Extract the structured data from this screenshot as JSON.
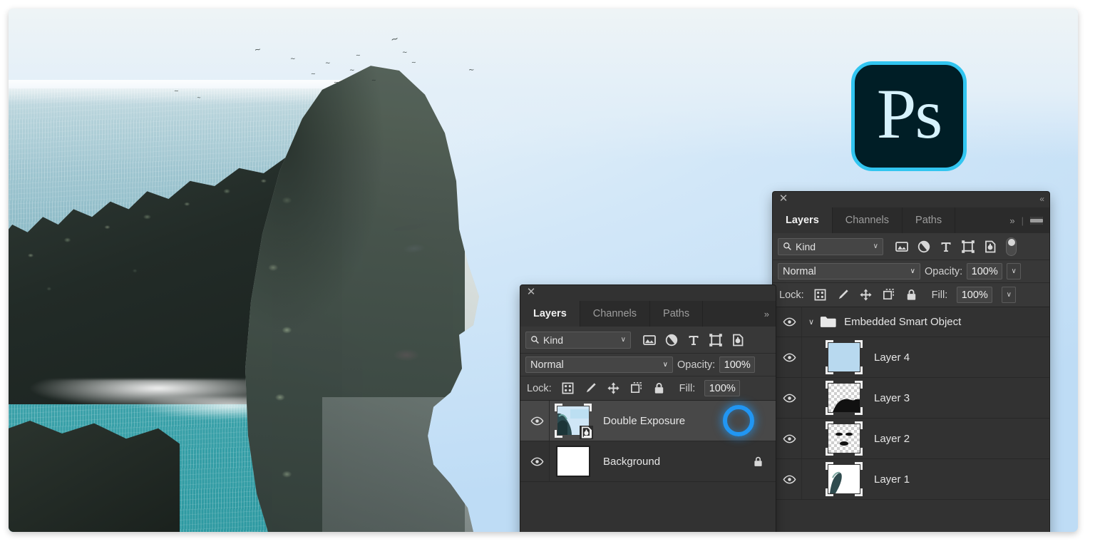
{
  "app": {
    "name": "Adobe Photoshop",
    "icon_label": "Ps",
    "icon_name": "photoshop-app-icon",
    "brand_accent": "#31c5f0",
    "icon_background": "#001e26"
  },
  "artwork": {
    "title": "Double Exposure composite",
    "description": "Woman's profile blended with coastal cliff, ocean and birds",
    "background_color": "#bedcf5"
  },
  "front_panel": {
    "name": "layers-panel-front",
    "titlebar": {
      "close_label": "✕",
      "collapse_label": "«"
    },
    "tabs": [
      {
        "label": "Layers",
        "active": true
      },
      {
        "label": "Channels",
        "active": false
      },
      {
        "label": "Paths",
        "active": false
      }
    ],
    "tab_overflow_label": "»",
    "filter": {
      "search_icon": "search-icon",
      "kind_label": "Kind",
      "caret": "∨",
      "icons": [
        "pixel-layer-filter-icon",
        "adjustment-layer-filter-icon",
        "type-layer-filter-icon",
        "shape-layer-filter-icon",
        "smart-object-filter-icon"
      ],
      "toggle_name": "filter-enable-toggle"
    },
    "blend": {
      "mode": "Normal",
      "caret": "∨",
      "opacity_label": "Opacity:",
      "opacity_value": "100%"
    },
    "lock": {
      "label": "Lock:",
      "icons": [
        "lock-transparent-pixels-icon",
        "lock-image-pixels-icon",
        "lock-position-icon",
        "lock-artboard-nesting-icon",
        "lock-all-icon"
      ],
      "fill_label": "Fill:",
      "fill_value": "100%"
    },
    "layers": [
      {
        "name": "Double Exposure",
        "visible": true,
        "selected": true,
        "thumb_type": "smart-object-photo",
        "locked": false,
        "has_selection_ring": true
      },
      {
        "name": "Background",
        "visible": true,
        "selected": false,
        "thumb_type": "white",
        "locked": true,
        "has_selection_ring": false
      }
    ]
  },
  "back_panel": {
    "name": "layers-panel-back",
    "titlebar": {
      "close_label": "✕",
      "collapse_label": "«"
    },
    "tabs": [
      {
        "label": "Layers",
        "active": true
      },
      {
        "label": "Channels",
        "active": false
      },
      {
        "label": "Paths",
        "active": false
      }
    ],
    "tab_overflow_label": "»",
    "panel_menu_label": "panel-menu-icon",
    "filter": {
      "search_icon": "search-icon",
      "kind_label": "Kind",
      "caret": "∨",
      "icons": [
        "pixel-layer-filter-icon",
        "adjustment-layer-filter-icon",
        "type-layer-filter-icon",
        "shape-layer-filter-icon",
        "smart-object-filter-icon"
      ],
      "toggle_name": "filter-enable-toggle"
    },
    "blend": {
      "mode": "Normal",
      "caret": "∨",
      "opacity_label": "Opacity:",
      "opacity_value": "100%"
    },
    "lock": {
      "label": "Lock:",
      "icons": [
        "lock-transparent-pixels-icon",
        "lock-image-pixels-icon",
        "lock-position-icon",
        "lock-artboard-nesting-icon",
        "lock-all-icon"
      ],
      "fill_label": "Fill:",
      "fill_value": "100%"
    },
    "group": {
      "name": "Embedded Smart Object",
      "visible": true,
      "expanded": true,
      "caret": "∨"
    },
    "layers": [
      {
        "name": "Layer 4",
        "visible": true,
        "thumb_type": "solid-blue"
      },
      {
        "name": "Layer 3",
        "visible": true,
        "thumb_type": "checker-black-shape"
      },
      {
        "name": "Layer 2",
        "visible": true,
        "thumb_type": "checker-face"
      },
      {
        "name": "Layer 1",
        "visible": true,
        "thumb_type": "photo"
      }
    ]
  }
}
